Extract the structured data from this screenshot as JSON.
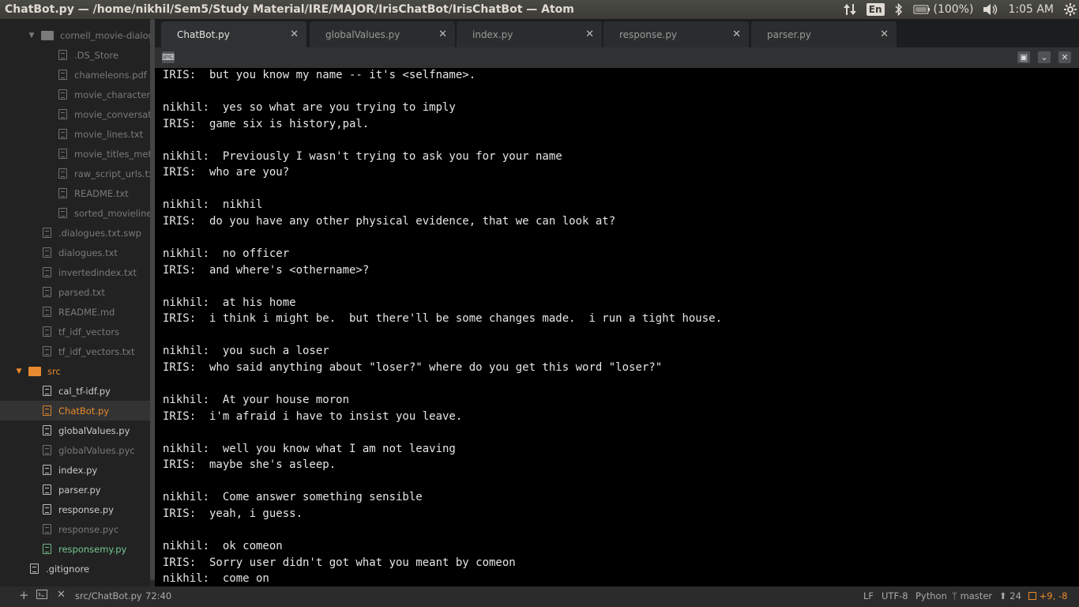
{
  "window": {
    "title": "ChatBot.py — /home/nikhil/Sem5/Study Material/IRE/MAJOR/IrisChatBot/IrisChatBot — Atom"
  },
  "system_tray": {
    "lang": "En",
    "battery": "(100%)",
    "time": "1:05 AM"
  },
  "tree": [
    {
      "label": "cornell_movie-dialog",
      "kind": "folder",
      "depth": 2,
      "state": "dim"
    },
    {
      "label": ".DS_Store",
      "kind": "file",
      "depth": 3,
      "state": "dim"
    },
    {
      "label": "chameleons.pdf",
      "kind": "file",
      "depth": 3,
      "state": "dim"
    },
    {
      "label": "movie_characters_",
      "kind": "file",
      "depth": 3,
      "state": "dim"
    },
    {
      "label": "movie_conversatio",
      "kind": "file",
      "depth": 3,
      "state": "dim"
    },
    {
      "label": "movie_lines.txt",
      "kind": "file",
      "depth": 3,
      "state": "dim"
    },
    {
      "label": "movie_titles_meta",
      "kind": "file",
      "depth": 3,
      "state": "dim"
    },
    {
      "label": "raw_script_urls.txt",
      "kind": "file",
      "depth": 3,
      "state": "dim"
    },
    {
      "label": "README.txt",
      "kind": "file",
      "depth": 3,
      "state": "dim"
    },
    {
      "label": "sorted_movielines",
      "kind": "file",
      "depth": 3,
      "state": "dim"
    },
    {
      "label": ".dialogues.txt.swp",
      "kind": "file",
      "depth": 2,
      "state": "dim"
    },
    {
      "label": "dialogues.txt",
      "kind": "file",
      "depth": 2,
      "state": "dim"
    },
    {
      "label": "invertedindex.txt",
      "kind": "file",
      "depth": 2,
      "state": "dim"
    },
    {
      "label": "parsed.txt",
      "kind": "file",
      "depth": 2,
      "state": "dim"
    },
    {
      "label": "README.md",
      "kind": "file",
      "depth": 2,
      "state": "dim"
    },
    {
      "label": "tf_idf_vectors",
      "kind": "file",
      "depth": 2,
      "state": "dim"
    },
    {
      "label": "tf_idf_vectors.txt",
      "kind": "file",
      "depth": 2,
      "state": "dim"
    },
    {
      "label": "src",
      "kind": "folder",
      "depth": 1,
      "state": "orange"
    },
    {
      "label": "cal_tf-idf.py",
      "kind": "file",
      "depth": 2,
      "state": "bright"
    },
    {
      "label": "ChatBot.py",
      "kind": "file",
      "depth": 2,
      "state": "active"
    },
    {
      "label": "globalValues.py",
      "kind": "file",
      "depth": 2,
      "state": "bright"
    },
    {
      "label": "globalValues.pyc",
      "kind": "file",
      "depth": 2,
      "state": "dim"
    },
    {
      "label": "index.py",
      "kind": "file",
      "depth": 2,
      "state": "bright"
    },
    {
      "label": "parser.py",
      "kind": "file",
      "depth": 2,
      "state": "bright"
    },
    {
      "label": "response.py",
      "kind": "file",
      "depth": 2,
      "state": "bright"
    },
    {
      "label": "response.pyc",
      "kind": "file",
      "depth": 2,
      "state": "dim"
    },
    {
      "label": "responsemy.py",
      "kind": "file",
      "depth": 2,
      "state": "green"
    },
    {
      "label": ".gitignore",
      "kind": "file",
      "depth": 1,
      "state": "bright"
    }
  ],
  "tabs": [
    {
      "label": "ChatBot.py",
      "active": true
    },
    {
      "label": "globalValues.py",
      "active": false
    },
    {
      "label": "index.py",
      "active": false
    },
    {
      "label": "response.py",
      "active": false
    },
    {
      "label": "parser.py",
      "active": false
    }
  ],
  "editor_lines": [
    "IRIS:  but you know my name -- it's <selfname>.",
    "",
    "nikhil:  yes so what are you trying to imply",
    "IRIS:  game six is history,pal.",
    "",
    "nikhil:  Previously I wasn't trying to ask you for your name",
    "IRIS:  who are you?",
    "",
    "nikhil:  nikhil",
    "IRIS:  do you have any other physical evidence, that we can look at?",
    "",
    "nikhil:  no officer",
    "IRIS:  and where's <othername>?",
    "",
    "nikhil:  at his home",
    "IRIS:  i think i might be.  but there'll be some changes made.  i run a tight house.",
    "",
    "nikhil:  you such a loser",
    "IRIS:  who said anything about \"loser?\" where do you get this word \"loser?\"",
    "",
    "nikhil:  At your house moron",
    "IRIS:  i'm afraid i have to insist you leave.",
    "",
    "nikhil:  well you know what I am not leaving",
    "IRIS:  maybe she's asleep.",
    "",
    "nikhil:  Come answer something sensible",
    "IRIS:  yeah, i guess.",
    "",
    "nikhil:  ok comeon",
    "IRIS:  Sorry user didn't got what you meant by comeon",
    "nikhil:  come on"
  ],
  "status": {
    "add": "+",
    "file_path": "src/ChatBot.py",
    "cursor": "72:40",
    "line_ending": "LF",
    "encoding": "UTF-8",
    "grammar": "Python",
    "branch": "master",
    "ahead": "24",
    "changes": "+9, -8"
  }
}
